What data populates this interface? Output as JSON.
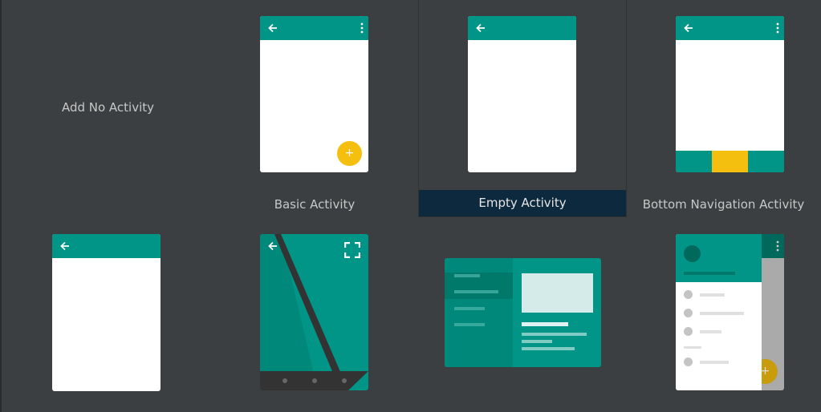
{
  "templates": [
    {
      "id": "add-no-activity",
      "label": "Add No Activity"
    },
    {
      "id": "basic-activity",
      "label": "Basic Activity"
    },
    {
      "id": "empty-activity",
      "label": "Empty Activity",
      "selected": true
    },
    {
      "id": "bottom-navigation-activity",
      "label": "Bottom Navigation Activity"
    },
    {
      "id": "empty-views-activity"
    },
    {
      "id": "fullscreen-activity"
    },
    {
      "id": "master-detail-flow"
    },
    {
      "id": "navigation-drawer-activity"
    }
  ],
  "icons": {
    "back": "arrow-left",
    "overflow": "more-vertical",
    "fab": "plus",
    "fullscreen": "fullscreen"
  },
  "fab_glyph": "+",
  "colors": {
    "background": "#3c3f41",
    "teal": "#009587",
    "dark_teal": "#00796b",
    "accent": "#f5bf10",
    "selection": "#0d293e",
    "caption": "#c7c7c7"
  }
}
